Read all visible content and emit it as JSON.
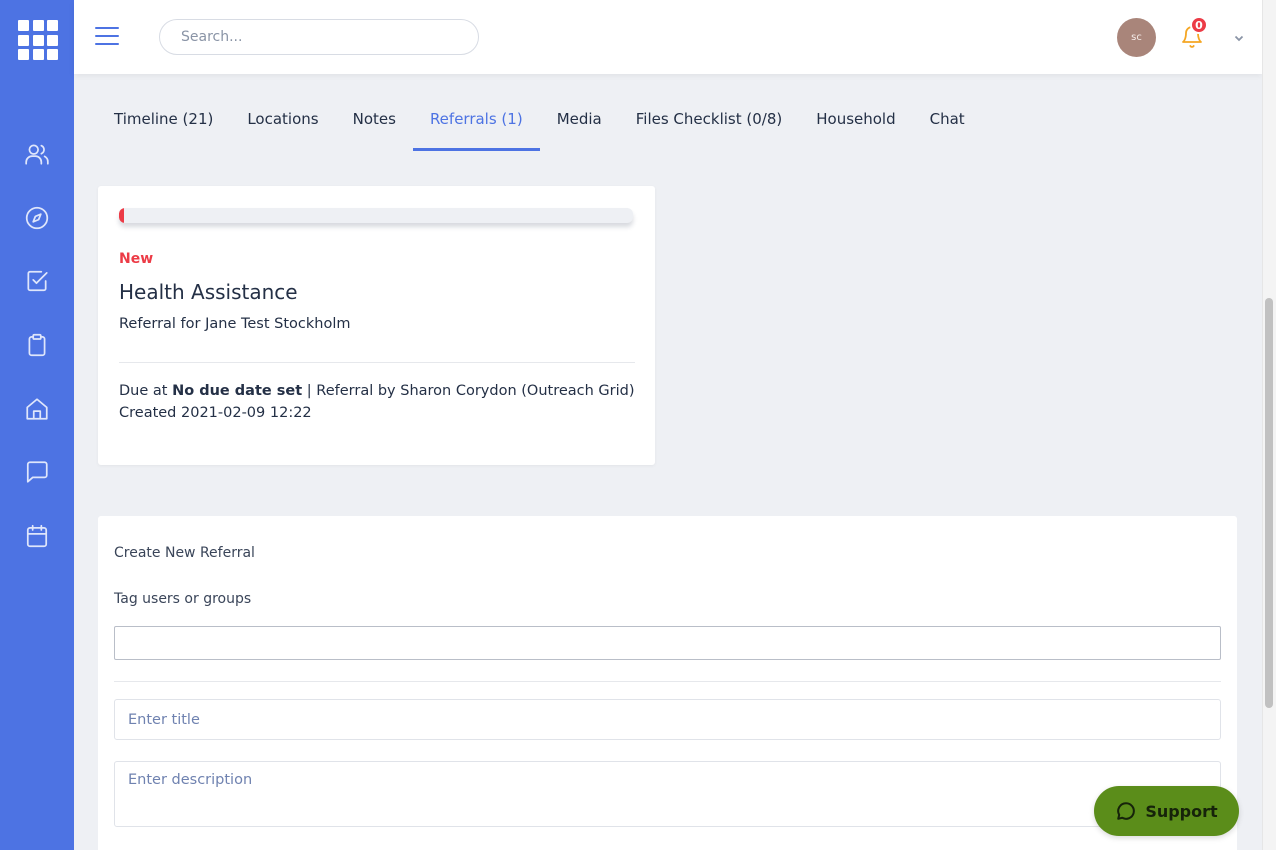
{
  "topbar": {
    "search_placeholder": "Search...",
    "avatar_initials": "sc",
    "notification_count": "0"
  },
  "sidebar": {
    "items": [
      {
        "icon": "users-icon"
      },
      {
        "icon": "compass-icon"
      },
      {
        "icon": "checkbox-icon"
      },
      {
        "icon": "clipboard-icon"
      },
      {
        "icon": "home-icon"
      },
      {
        "icon": "chat-icon"
      },
      {
        "icon": "calendar-icon"
      }
    ]
  },
  "tabs": [
    {
      "label": "Timeline (21)"
    },
    {
      "label": "Locations"
    },
    {
      "label": "Notes"
    },
    {
      "label": "Referrals (1)",
      "active": true
    },
    {
      "label": "Media"
    },
    {
      "label": "Files Checklist (0/8)"
    },
    {
      "label": "Household"
    },
    {
      "label": "Chat"
    }
  ],
  "referral": {
    "progress_fraction": 0.01,
    "status": "New",
    "title": "Health Assistance",
    "subtitle": "Referral for Jane Test Stockholm",
    "due_prefix": "Due at",
    "due_value": "No due date set",
    "referral_by": "| Referral by Sharon Corydon (Outreach Grid)",
    "created": "Created 2021-02-09 12:22"
  },
  "create_form": {
    "heading": "Create New Referral",
    "tag_label": "Tag users or groups",
    "title_placeholder": "Enter title",
    "description_placeholder": "Enter description"
  },
  "support": {
    "label": "Support"
  },
  "colors": {
    "sidebar": "#4d73e3",
    "accent": "#4d73e3",
    "status_new": "#ec3b46",
    "support_button": "#5b8d1a",
    "notification": "#f5a623"
  }
}
